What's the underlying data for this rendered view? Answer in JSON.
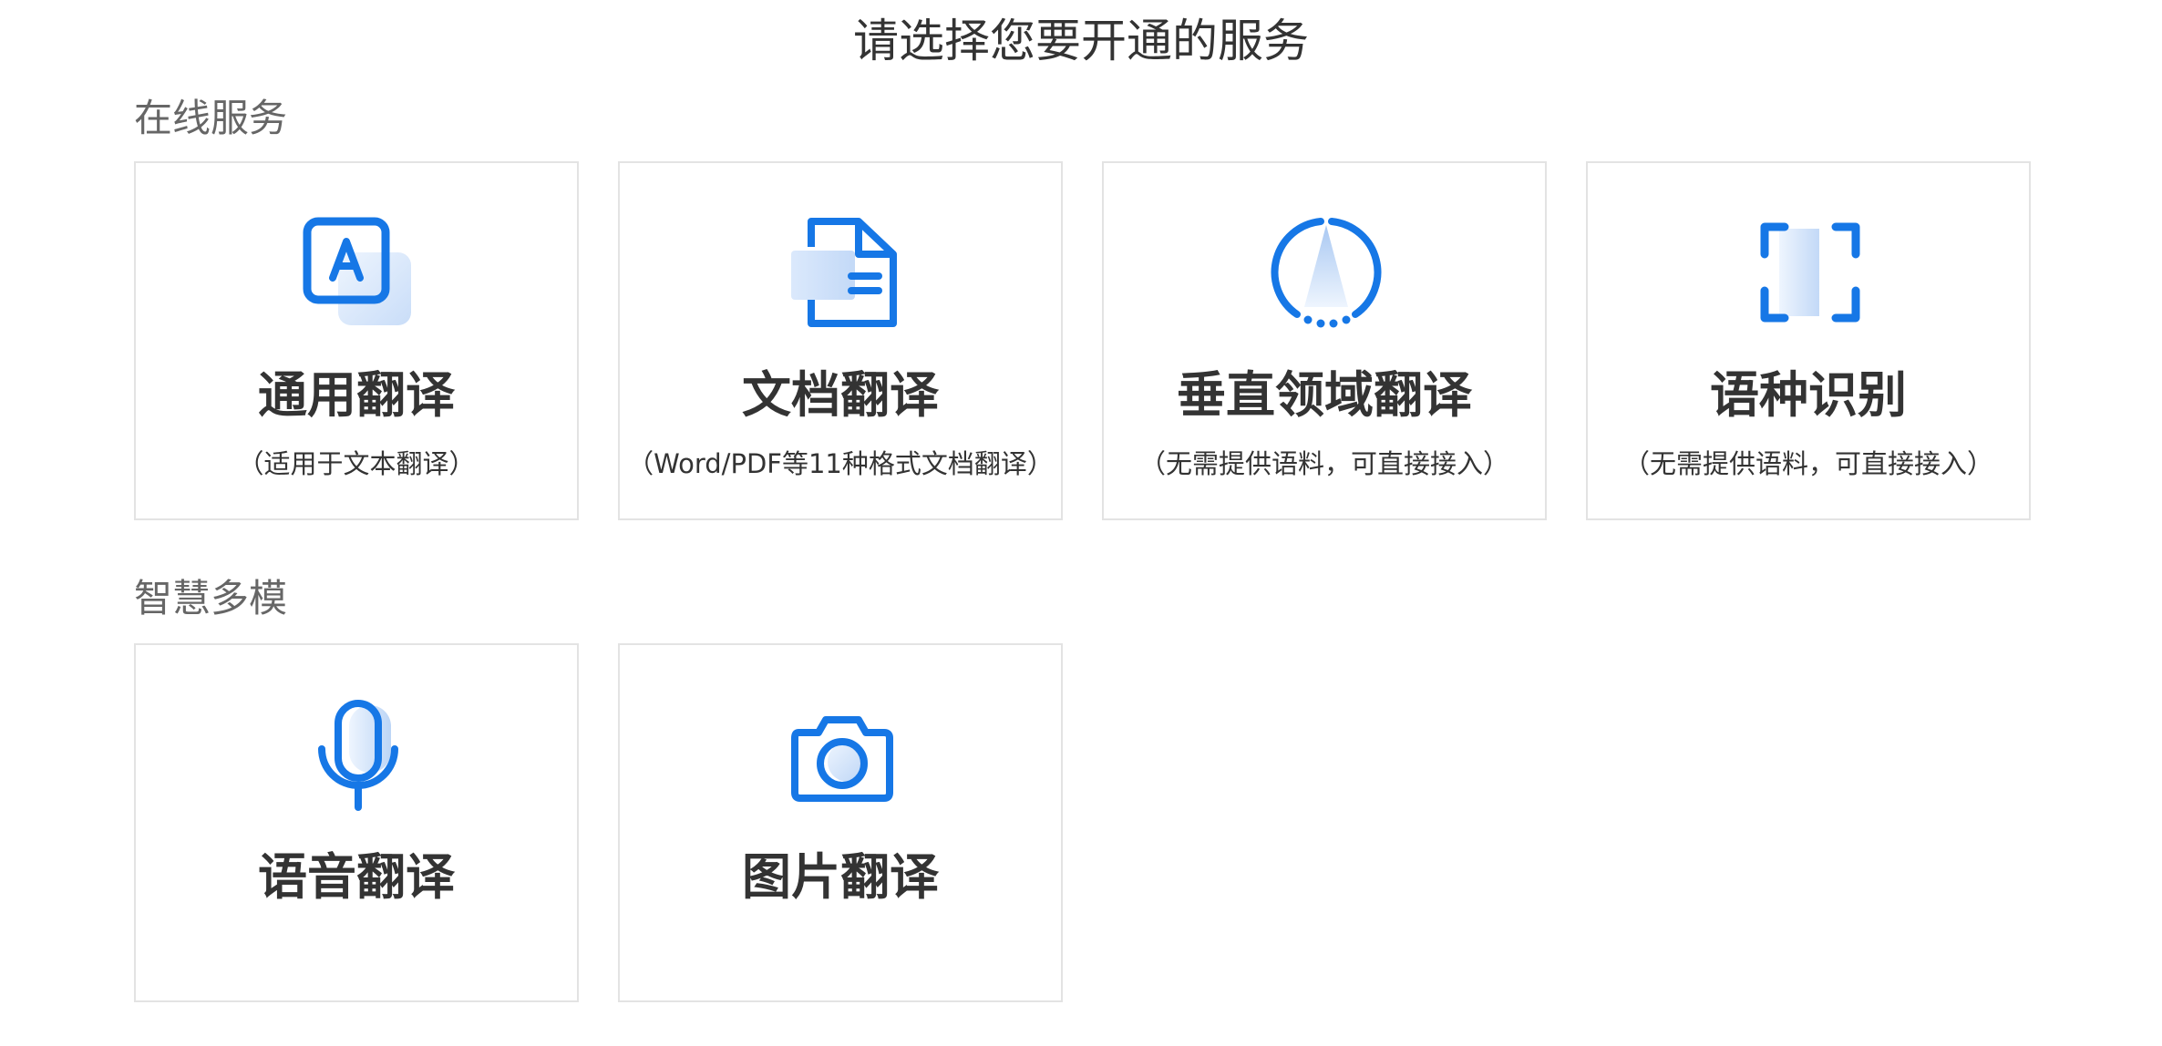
{
  "page": {
    "title": "请选择您要开通的服务"
  },
  "sections": [
    {
      "label": "在线服务",
      "cards": [
        {
          "icon": "text-translate-icon",
          "title": "通用翻译",
          "desc": "（适用于文本翻译）"
        },
        {
          "icon": "document-icon",
          "title": "文档翻译",
          "desc": "（Word/PDF等11种格式文档翻译）"
        },
        {
          "icon": "domain-gauge-icon",
          "title": "垂直领域翻译",
          "desc": "（无需提供语料，可直接接入）"
        },
        {
          "icon": "scan-frame-icon",
          "title": "语种识别",
          "desc": "（无需提供语料，可直接接入）"
        }
      ]
    },
    {
      "label": "智慧多模",
      "cards": [
        {
          "icon": "microphone-icon",
          "title": "语音翻译"
        },
        {
          "icon": "camera-icon",
          "title": "图片翻译"
        }
      ]
    }
  ],
  "colors": {
    "accent": "#1677e6",
    "accent_light": "#d6e6fb",
    "border": "#e3e3e3",
    "title_text": "#333333",
    "section_text": "#666666"
  }
}
